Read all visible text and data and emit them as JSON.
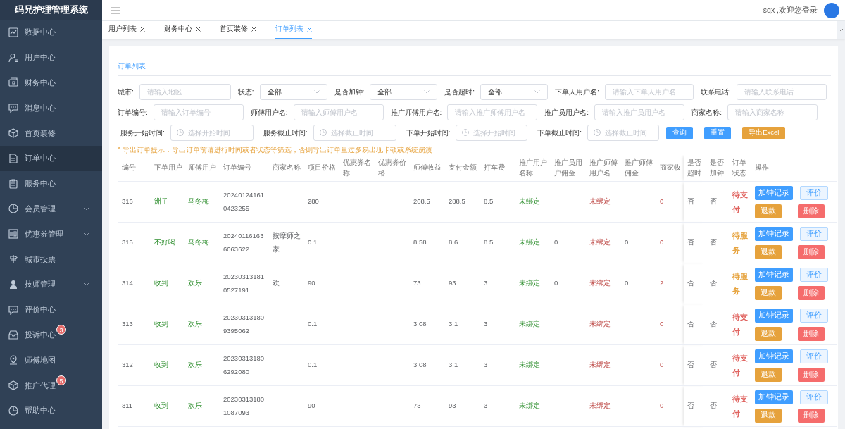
{
  "sidebar": {
    "title": "码兄护理管理系统",
    "items": [
      {
        "label": "数据中心",
        "selected": false,
        "expandable": false
      },
      {
        "label": "用户中心",
        "selected": false,
        "expandable": false
      },
      {
        "label": "财务中心",
        "selected": false,
        "expandable": false
      },
      {
        "label": "消息中心",
        "selected": false,
        "expandable": false
      },
      {
        "label": "首页装修",
        "selected": false,
        "expandable": false
      },
      {
        "label": "订单中心",
        "selected": true,
        "expandable": false
      },
      {
        "label": "服务中心",
        "selected": false,
        "expandable": false
      },
      {
        "label": "会员管理",
        "selected": false,
        "expandable": true
      },
      {
        "label": "优惠券管理",
        "selected": false,
        "expandable": true
      },
      {
        "label": "城市投票",
        "selected": false,
        "expandable": false
      },
      {
        "label": "技师管理",
        "selected": false,
        "expandable": true
      },
      {
        "label": "评价中心",
        "selected": false,
        "expandable": false
      },
      {
        "label": "投诉中心",
        "selected": false,
        "expandable": false,
        "badge": "3"
      },
      {
        "label": "师傅地图",
        "selected": false,
        "expandable": false
      },
      {
        "label": "推广代理",
        "selected": false,
        "expandable": false,
        "badge": "5"
      },
      {
        "label": "帮助中心",
        "selected": false,
        "expandable": false
      }
    ]
  },
  "header": {
    "greeting": "sqx ,欢迎您登录"
  },
  "tabs": [
    {
      "label": "用户列表",
      "selected": false
    },
    {
      "label": "财务中心",
      "selected": false
    },
    {
      "label": "首页装修",
      "selected": false
    },
    {
      "label": "订单列表",
      "selected": true
    }
  ],
  "panel": {
    "tab": "订单列表",
    "filters": [
      [
        {
          "label": "城市:",
          "kind": "input",
          "placeholder": "请输入地区"
        },
        {
          "label": "状态:",
          "kind": "select",
          "value": "全部"
        },
        {
          "label": "是否加钟:",
          "kind": "select",
          "value": "全部"
        },
        {
          "label": "是否超时:",
          "kind": "select",
          "value": "全部"
        },
        {
          "label": "下单人用户名:",
          "kind": "input",
          "placeholder": "请输入下单人用户名"
        },
        {
          "label": "联系电话:",
          "kind": "input",
          "placeholder": "请输入联系电话"
        }
      ],
      [
        {
          "label": "订单编号:",
          "kind": "input",
          "placeholder": "请输入订单编号"
        },
        {
          "label": "师傅用户名:",
          "kind": "input",
          "placeholder": "请输入师傅用户名"
        },
        {
          "label": "推广师傅用户名:",
          "kind": "input",
          "placeholder": "请输入推广师傅用户名"
        },
        {
          "label": "推广员用户名:",
          "kind": "input",
          "placeholder": "请输入推广员用户名"
        },
        {
          "label": "商家名称:",
          "kind": "input",
          "placeholder": "请输入商家名称"
        }
      ],
      [
        {
          "label": "服务开始时间:",
          "kind": "date",
          "placeholder": "选择开始时间"
        },
        {
          "label": "服务截止时间:",
          "kind": "date",
          "placeholder": "选择截止时间"
        },
        {
          "label": "下单开始时间:",
          "kind": "date",
          "placeholder": "选择开始时间"
        },
        {
          "label": "下单截止时间:",
          "kind": "date",
          "placeholder": "选择截止时间"
        }
      ]
    ],
    "buttons": [
      {
        "label": "查询",
        "kind": "primary"
      },
      {
        "label": "重置",
        "kind": "primary"
      },
      {
        "label": "导出Excel",
        "kind": "warning"
      }
    ],
    "notice": "* 导出订单提示：导出订单前请进行时间或者状态等筛选，否则导出订单量过多易出现卡顿或系统崩溃"
  },
  "table": {
    "columns": [
      "编号",
      "下单用户",
      "师傅用户",
      "订单编号",
      "商家名称",
      "项目价格",
      "优惠券名称",
      "优惠券价格",
      "师傅收益",
      "支付金额",
      "打车费",
      "推广用户名称",
      "推广员用户佣金",
      "推广师傅用户名",
      "推广师傅佣金",
      "商家收",
      "是否超时",
      "是否加钟",
      "订单状态",
      "操作"
    ],
    "rows": [
      {
        "cells": [
          "316",
          "洲子",
          "马冬梅",
          "202401241610423255",
          "",
          "280",
          "",
          "",
          "208.5",
          "288.5",
          "8.5",
          "未绑定",
          "",
          "未绑定",
          "",
          "0",
          "否",
          "否"
        ],
        "status": {
          "text": "待支付",
          "color": "#e0635f"
        },
        "actions": [
          {
            "label": "加钟记录",
            "kind": "primary"
          },
          {
            "label": "评价",
            "kind": "plain"
          },
          {
            "label": "退款",
            "kind": "warning"
          },
          {
            "label": "删除",
            "kind": "danger"
          }
        ]
      },
      {
        "cells": [
          "315",
          "不好喝",
          "马冬梅",
          "202401161636063622",
          "按摩师之家",
          "0.1",
          "",
          "",
          "8.58",
          "8.6",
          "8.5",
          "未绑定",
          "0",
          "未绑定",
          "0",
          "0",
          "否",
          "否"
        ],
        "status": {
          "text": "待服务",
          "color": "#e6a23c"
        },
        "actions": [
          {
            "label": "加钟记录",
            "kind": "primary"
          },
          {
            "label": "评价",
            "kind": "plain"
          },
          {
            "label": "退款",
            "kind": "warning"
          },
          {
            "label": "删除",
            "kind": "danger"
          }
        ]
      },
      {
        "cells": [
          "314",
          "收到",
          "欢乐",
          "202303131810527191",
          "欢",
          "90",
          "",
          "",
          "73",
          "93",
          "3",
          "未绑定",
          "0",
          "未绑定",
          "0",
          "2",
          "否",
          "否"
        ],
        "status": {
          "text": "待服务",
          "color": "#e6a23c"
        },
        "actions": [
          {
            "label": "加钟记录",
            "kind": "primary"
          },
          {
            "label": "评价",
            "kind": "plain"
          },
          {
            "label": "退款",
            "kind": "warning"
          },
          {
            "label": "删除",
            "kind": "danger"
          }
        ]
      },
      {
        "cells": [
          "313",
          "收到",
          "欢乐",
          "202303131809395062",
          "",
          "0.1",
          "",
          "",
          "3.08",
          "3.1",
          "3",
          "未绑定",
          "",
          "未绑定",
          "",
          "0",
          "否",
          "否"
        ],
        "status": {
          "text": "待支付",
          "color": "#e0635f"
        },
        "actions": [
          {
            "label": "加钟记录",
            "kind": "primary"
          },
          {
            "label": "评价",
            "kind": "plain"
          },
          {
            "label": "退款",
            "kind": "warning"
          },
          {
            "label": "删除",
            "kind": "danger"
          }
        ]
      },
      {
        "cells": [
          "312",
          "收到",
          "欢乐",
          "202303131806292080",
          "",
          "0.1",
          "",
          "",
          "3.08",
          "3.1",
          "3",
          "未绑定",
          "",
          "未绑定",
          "",
          "0",
          "否",
          "否"
        ],
        "status": {
          "text": "待支付",
          "color": "#e0635f"
        },
        "actions": [
          {
            "label": "加钟记录",
            "kind": "primary"
          },
          {
            "label": "评价",
            "kind": "plain"
          },
          {
            "label": "退款",
            "kind": "warning"
          },
          {
            "label": "删除",
            "kind": "danger"
          }
        ]
      },
      {
        "cells": [
          "311",
          "收到",
          "欢乐",
          "202303131801087093",
          "",
          "90",
          "",
          "",
          "73",
          "93",
          "3",
          "未绑定",
          "",
          "未绑定",
          "",
          "0",
          "否",
          "否"
        ],
        "status": {
          "text": "待支付",
          "color": "#e0635f"
        },
        "actions": [
          {
            "label": "加钟记录",
            "kind": "primary"
          },
          {
            "label": "评价",
            "kind": "plain"
          },
          {
            "label": "退款",
            "kind": "warning"
          },
          {
            "label": "删除",
            "kind": "danger"
          }
        ]
      }
    ]
  }
}
